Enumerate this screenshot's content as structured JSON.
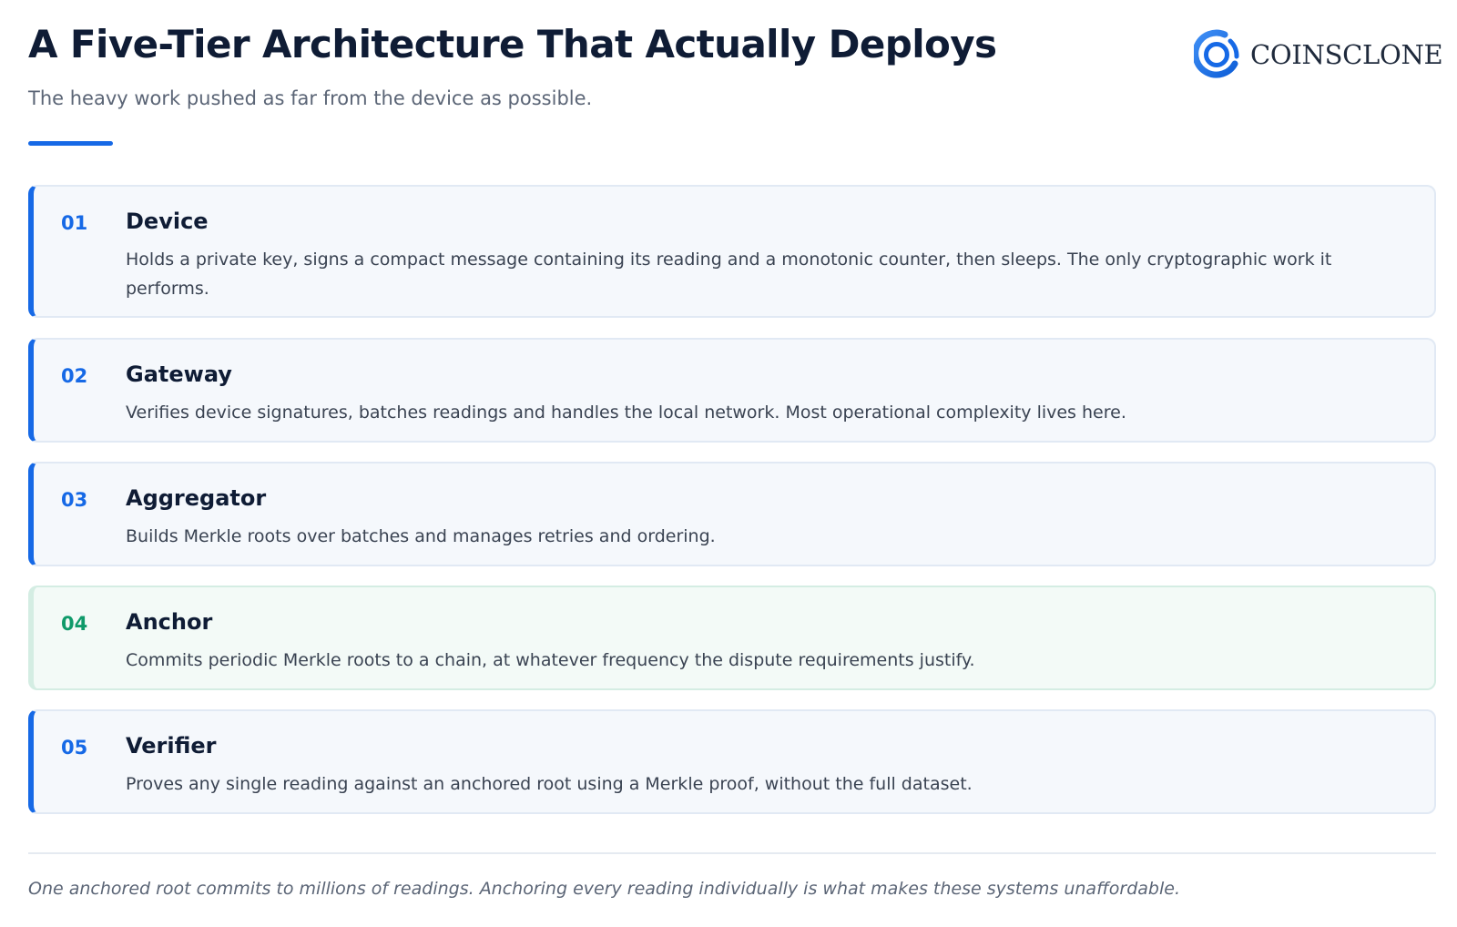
{
  "header": {
    "title": "A Five-Tier Architecture That Actually Deploys",
    "subtitle": "The heavy work pushed as far from the device as possible."
  },
  "logo": {
    "text": "COINSCLONE",
    "icon": "coinsclone-ring-logo-icon",
    "color": "#1669e6"
  },
  "tiers": [
    {
      "number": "01",
      "name": "Device",
      "description": "Holds a private key, signs a compact message containing its reading and a monotonic counter, then sleeps. The only cryptographic work it performs."
    },
    {
      "number": "02",
      "name": "Gateway",
      "description": "Verifies device signatures, batches readings and handles the local network. Most operational complexity lives here."
    },
    {
      "number": "03",
      "name": "Aggregator",
      "description": "Builds Merkle roots over batches and manages retries and ordering."
    },
    {
      "number": "04",
      "name": "Anchor",
      "description": "Commits periodic Merkle roots to a chain, at whatever frequency the dispute requirements justify."
    },
    {
      "number": "05",
      "name": "Verifier",
      "description": "Proves any single reading against an anchored root using a Merkle proof, without the full dataset."
    }
  ],
  "footer": {
    "note": "One anchored root commits to millions of readings. Anchoring every reading individually is what makes these systems unaffordable."
  },
  "colors": {
    "accent_blue": "#1669e6",
    "accent_green": "#0f9a6a",
    "title": "#0f1c35",
    "muted_text": "#5b6576",
    "card_background": "#f5f8fc",
    "highlight_card_background": "#f3faf7"
  }
}
